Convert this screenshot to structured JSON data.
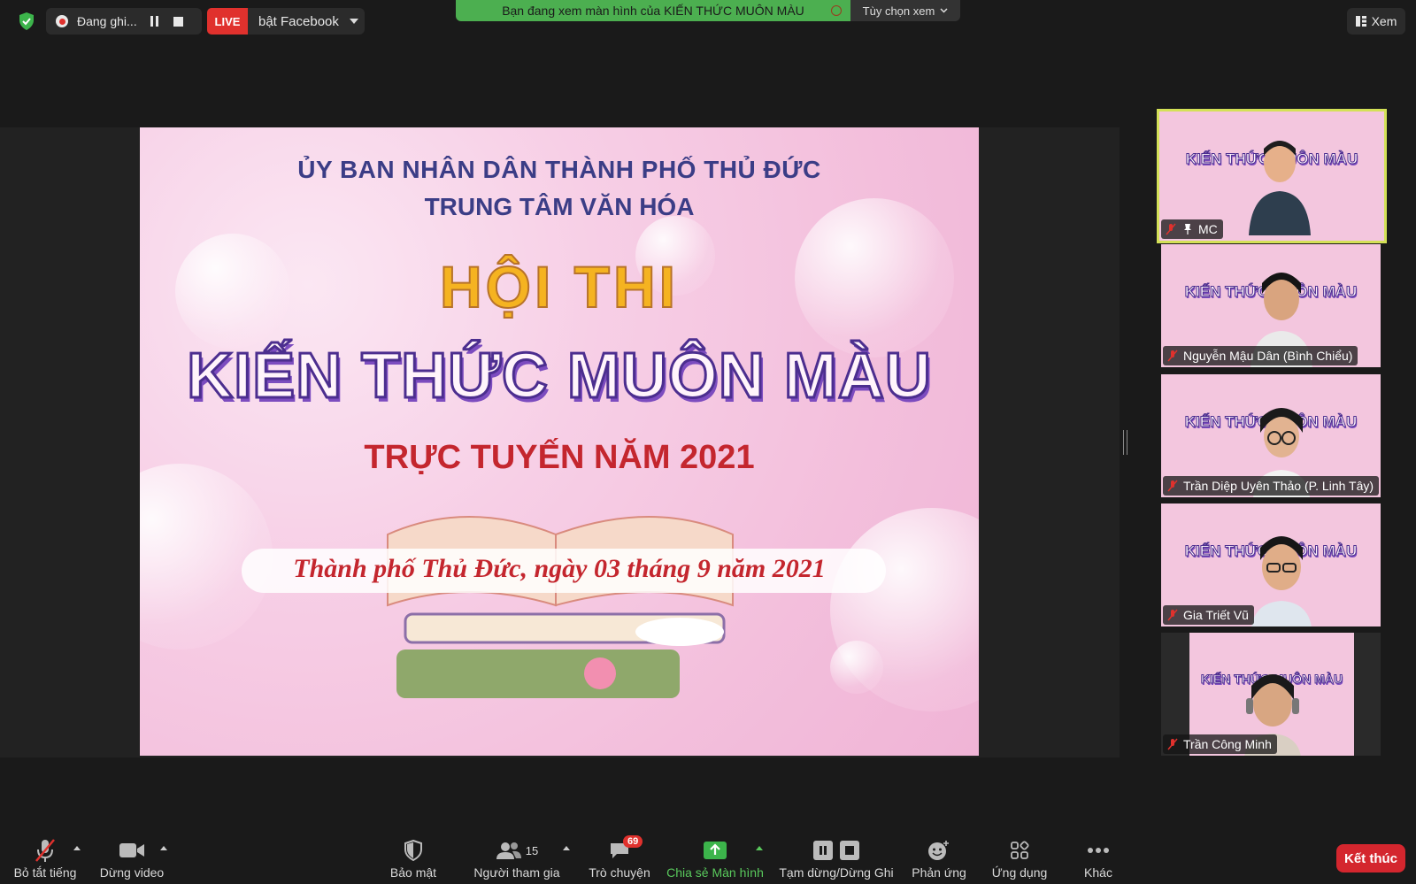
{
  "topbar": {
    "security_icon": "shield-check-icon",
    "recording_label": "Đang ghi...",
    "live_badge": "LIVE",
    "live_label": "bật Facebook",
    "share_banner": "Bạn đang xem màn hình của KIẾN THỨC MUÔN MÀU",
    "view_options": "Tùy chọn xem",
    "view_button": "Xem"
  },
  "slide": {
    "line1": "ỦY BAN NHÂN DÂN THÀNH PHỐ THỦ ĐỨC",
    "line2": "TRUNG TÂM VĂN HÓA",
    "hoi_thi": "HỘI THI",
    "title": "KIẾN THỨC MUÔN MÀU",
    "subtitle": "TRỰC TUYẾN NĂM 2021",
    "date": "Thành phố Thủ Đức, ngày 03 tháng 9 năm 2021"
  },
  "participants": [
    {
      "name": "MC",
      "pinned": true,
      "muted": true
    },
    {
      "name": "Nguyễn Mậu Dân (Bình Chiểu)",
      "muted": true
    },
    {
      "name": "Trần Diệp Uyên Thảo (P. Linh Tây)",
      "muted": true
    },
    {
      "name": "Gia Triết Vũ",
      "muted": true
    },
    {
      "name": "Trần Công Minh",
      "muted": true
    }
  ],
  "toolbar": {
    "mute_all": "Bỏ tắt tiếng",
    "stop_video": "Dừng video",
    "security": "Bảo mật",
    "participants": "Người tham gia",
    "participants_count": "15",
    "chat": "Trò chuyện",
    "chat_badge": "69",
    "share_screen": "Chia sẻ Màn hình",
    "pause_record": "Tạm dừng/Dừng Ghi",
    "reactions": "Phản ứng",
    "apps": "Ứng dụng",
    "more": "Khác",
    "end": "Kết thúc"
  },
  "colors": {
    "accent_green": "#4caf50",
    "live_red": "#e0312d",
    "end_red": "#d4262e",
    "active_speaker": "#d4e157"
  }
}
